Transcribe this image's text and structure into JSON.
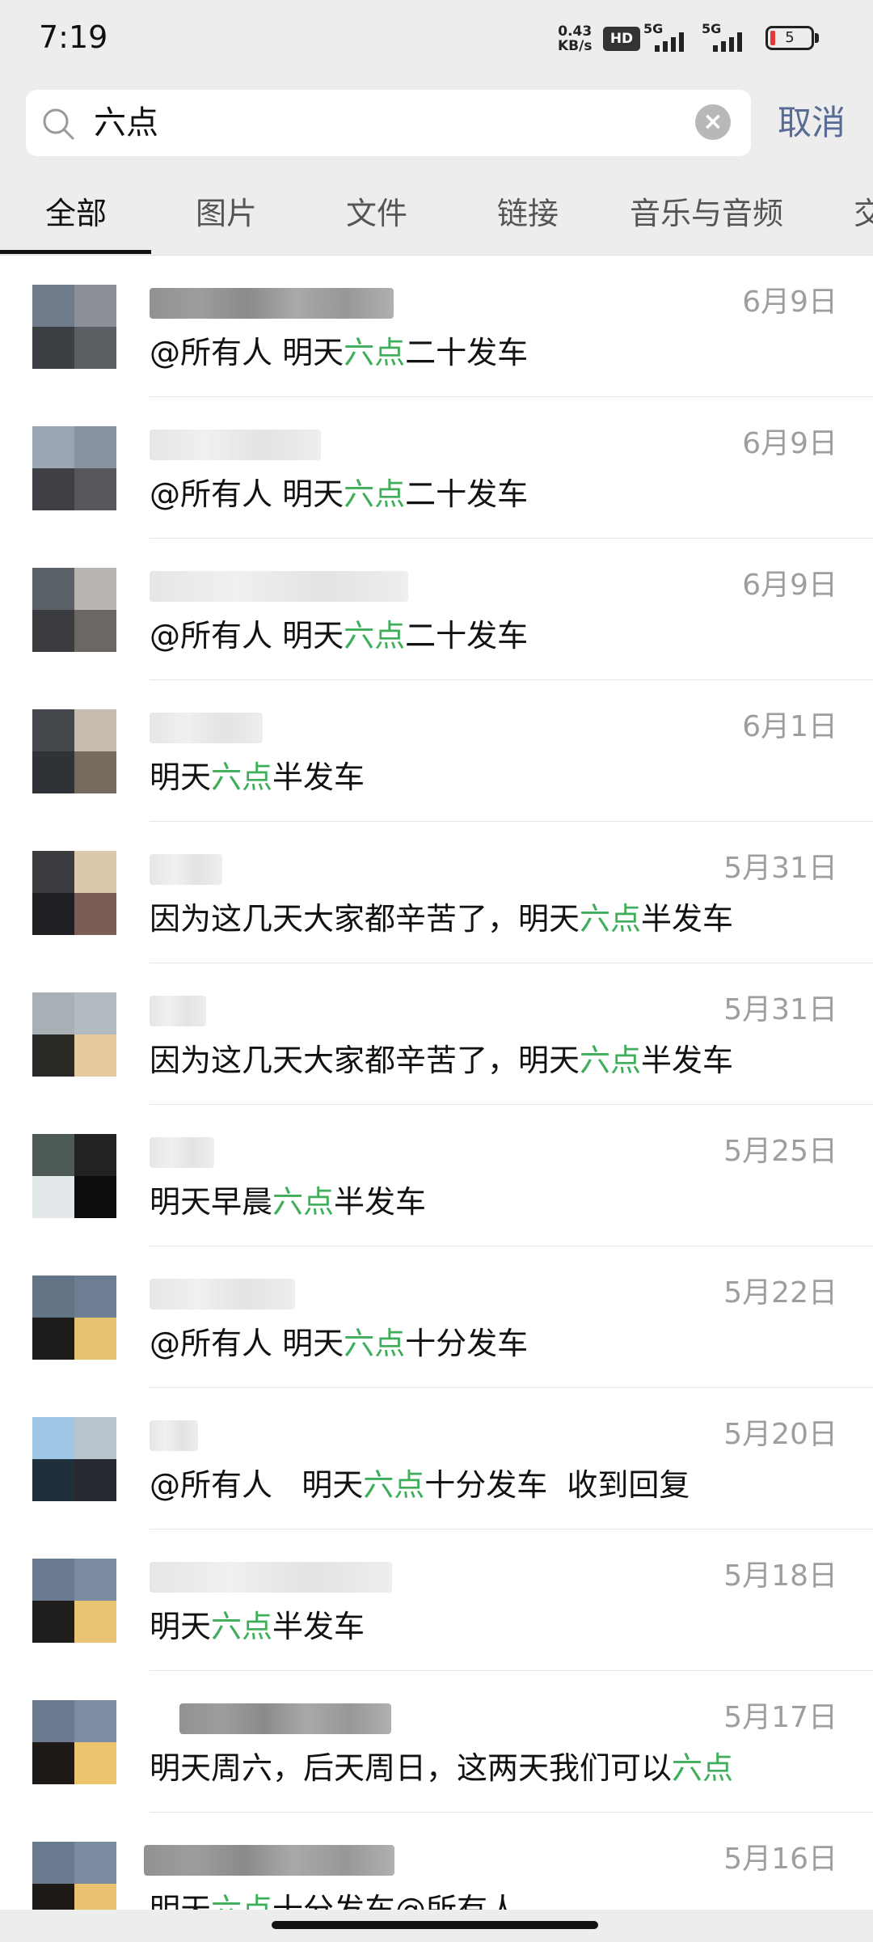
{
  "status_bar": {
    "time": "7:19",
    "net_speed_value": "0.43",
    "net_speed_unit": "KB/s",
    "hd_badge": "HD",
    "signal1_label": "5G",
    "signal2_label": "5G",
    "battery_level": "5"
  },
  "search": {
    "query": "六点",
    "cancel_label": "取消"
  },
  "tabs": [
    "全部",
    "图片",
    "文件",
    "链接",
    "音乐与音频",
    "交"
  ],
  "active_tab": 0,
  "colors": {
    "highlight": "#3fae5b",
    "link_blue": "#576b95",
    "date_gray": "#9e9e9e"
  },
  "results": [
    {
      "date": "6月9日",
      "pre": "@所有人 明天",
      "hl": "六点",
      "post": "二十发车"
    },
    {
      "date": "6月9日",
      "pre": "@所有人 明天",
      "hl": "六点",
      "post": "二十发车"
    },
    {
      "date": "6月9日",
      "pre": "@所有人 明天",
      "hl": "六点",
      "post": "二十发车"
    },
    {
      "date": "6月1日",
      "pre": "明天",
      "hl": "六点",
      "post": "半发车"
    },
    {
      "date": "5月31日",
      "pre": "因为这几天大家都辛苦了，明天",
      "hl": "六点",
      "post": "半发车"
    },
    {
      "date": "5月31日",
      "pre": "因为这几天大家都辛苦了，明天",
      "hl": "六点",
      "post": "半发车"
    },
    {
      "date": "5月25日",
      "pre": "明天早晨",
      "hl": "六点",
      "post": "半发车"
    },
    {
      "date": "5月22日",
      "pre": "@所有人 明天",
      "hl": "六点",
      "post": "十分发车"
    },
    {
      "date": "5月20日",
      "pre": "@所有人   明天",
      "hl": "六点",
      "post": "十分发车  收到回复"
    },
    {
      "date": "5月18日",
      "pre": "明天",
      "hl": "六点",
      "post": "半发车"
    },
    {
      "date": "5月17日",
      "pre": "明天周六，后天周日，这两天我们可以",
      "hl": "六点",
      "post": ""
    },
    {
      "date": "5月16日",
      "pre": "明天",
      "hl": "六点",
      "post": "十分发车@所有人"
    }
  ]
}
